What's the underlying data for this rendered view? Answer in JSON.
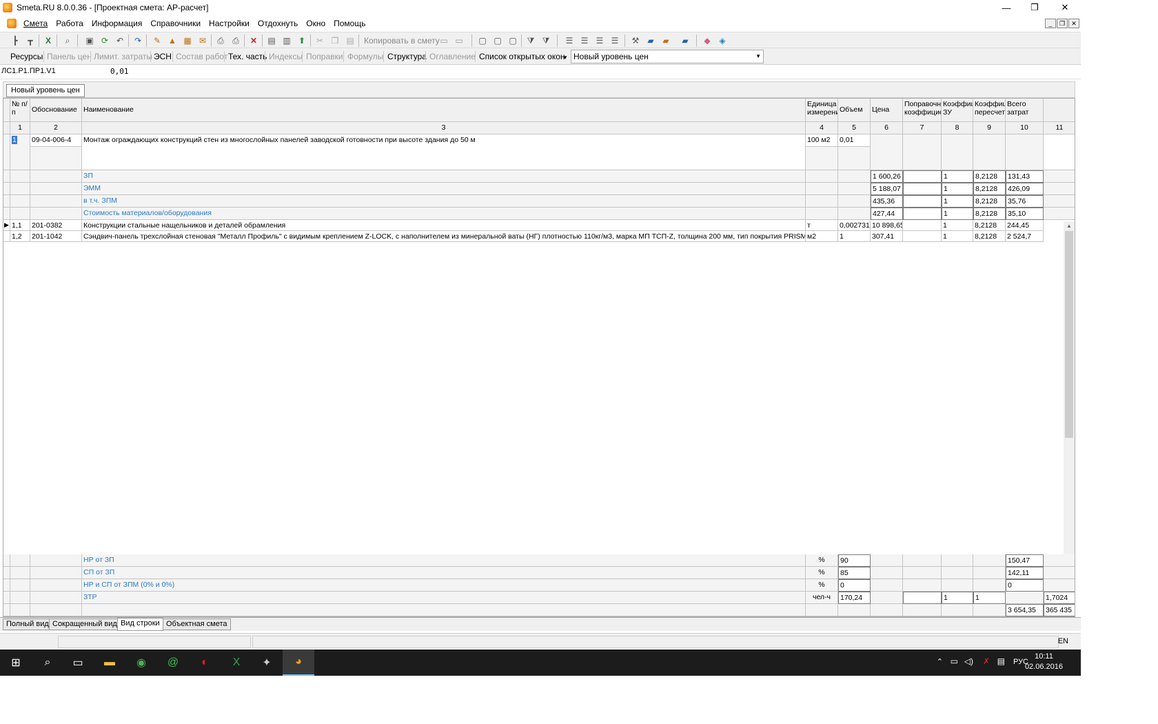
{
  "window": {
    "title": "Smeta.RU  8.0.0.36  - [Проектная смета: АР-расчет]",
    "minimize": "—",
    "restore": "❐",
    "close": "✕"
  },
  "menu": [
    "Смета",
    "Работа",
    "Информация",
    "Справочники",
    "Настройки",
    "Отдохнуть",
    "Окно",
    "Помощь"
  ],
  "toolbar": {
    "copy_label": "Копировать в смету"
  },
  "toolbar2": {
    "items": [
      "Ресурсы",
      "Панель цен",
      "Лимит. затраты",
      "ЭСН",
      "Состав работ",
      "Тех. часть",
      "Индексы",
      "Поправки",
      "Формулы",
      "Структура",
      "Оглавление",
      "Список открытых окон"
    ],
    "level_combo": "Новый уровень цен"
  },
  "formula": {
    "cell_ref": "ЛС1.Р1.ПР1.V1",
    "value": "0,01"
  },
  "sheet_tab": "Новый уровень цен",
  "columns": {
    "names": [
      "№ п/п",
      "Обоснование",
      "Наименование",
      "Единица измерени",
      "Объем",
      "Цена",
      "Поправочн коэффицие",
      "Коэффиц ЗУ",
      "Коэффиц пересчет",
      "Всего затрат",
      ""
    ],
    "numbers": [
      "1",
      "2",
      "3",
      "4",
      "5",
      "6",
      "7",
      "8",
      "9",
      "10",
      "11"
    ]
  },
  "main_row": {
    "num": "1",
    "code": "09-04-006-4",
    "name": "Монтаж ограждающих конструкций стен из многослойных панелей заводской готовности при высоте здания до 50 м",
    "unit": "100 м2",
    "volume": "0,01"
  },
  "cost_rows": [
    {
      "name": "ЗП",
      "price": "1 600,26",
      "k8": "1",
      "k9": "8,2128",
      "total": "131,43"
    },
    {
      "name": "ЭММ",
      "price": "5 188,07",
      "k8": "1",
      "k9": "8,2128",
      "total": "426,09"
    },
    {
      "name": "в т.ч. ЗПМ",
      "price": "435,36",
      "k8": "1",
      "k9": "8,2128",
      "total": "35,76"
    },
    {
      "name": "Стоимость материалов/оборудования",
      "price": "427,44",
      "k8": "1",
      "k9": "8,2128",
      "total": "35,10"
    }
  ],
  "resource_rows": [
    {
      "num": "1,1",
      "code": "201-0382",
      "name": "Конструкции стальные нащельников и деталей обрамления",
      "unit": "т",
      "volume": "0,002731",
      "price": "10 898,65",
      "k8": "1",
      "k9": "8,2128",
      "total": "244,45"
    },
    {
      "num": "1,2",
      "code": "201-1042",
      "name": "Сэндвич-панель трехслойная стеновая \"Металл Профиль\" с видимым креплением Z-LOCK, с наполнителем из минеральной ваты (НГ) плотностью 110кг/м3, марка МП ТСП-Z, толщина 200 мм, тип покрытия PRISMA, то",
      "unit": "м2",
      "volume": "1",
      "price": "307,41",
      "k8": "1",
      "k9": "8,2128",
      "total": "2 524,7"
    }
  ],
  "footer_rows": [
    {
      "name": "НР от ЗП",
      "unit": "%",
      "volume": "90",
      "k8": "",
      "k9": "",
      "total": "150,47",
      "c11": ""
    },
    {
      "name": "СП от ЗП",
      "unit": "%",
      "volume": "85",
      "k8": "",
      "k9": "",
      "total": "142,11",
      "c11": ""
    },
    {
      "name": "НР и СП от ЗПМ (0% и 0%)",
      "unit": "%",
      "volume": "0",
      "k8": "",
      "k9": "",
      "total": "0",
      "c11": ""
    },
    {
      "name": "ЗТР",
      "unit": "чел-ч",
      "volume": "170,24",
      "k8": "1",
      "k9": "1",
      "total": "",
      "c11": "1,7024"
    }
  ],
  "totals": {
    "total": "3 654,35",
    "c11": "365 435"
  },
  "bottom_tabs": [
    "Полный вид",
    "Сокращенный вид",
    "Вид строки",
    "Объектная смета"
  ],
  "status": {
    "right": "EN"
  },
  "taskbar": {
    "lang": "РУС",
    "time": "10:11",
    "date": "02.06.2016"
  }
}
